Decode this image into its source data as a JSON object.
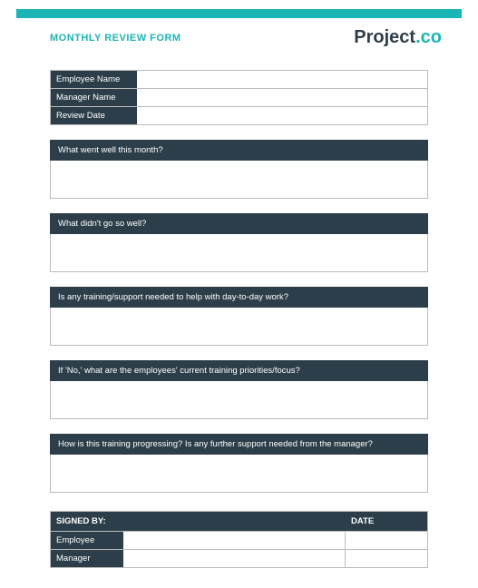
{
  "header": {
    "title": "MONTHLY REVIEW FORM",
    "logo_part1": "Project",
    "logo_part2": ".co"
  },
  "info_rows": [
    {
      "label": "Employee Name",
      "value": ""
    },
    {
      "label": "Manager Name",
      "value": ""
    },
    {
      "label": "Review Date",
      "value": ""
    }
  ],
  "questions": [
    {
      "label": "What went well this month?",
      "value": ""
    },
    {
      "label": "What didn't go so well?",
      "value": ""
    },
    {
      "label": "Is any training/support needed to help with day-to-day work?",
      "value": ""
    },
    {
      "label": "If 'No,' what are the employees' current training priorities/focus?",
      "value": ""
    },
    {
      "label": "How is this training progressing? Is any further support needed from the manager?",
      "value": ""
    }
  ],
  "sign": {
    "header_signed": "SIGNED BY:",
    "header_date": "DATE",
    "rows": [
      {
        "label": "Employee",
        "signature": "",
        "date": ""
      },
      {
        "label": "Manager",
        "signature": "",
        "date": ""
      }
    ]
  }
}
